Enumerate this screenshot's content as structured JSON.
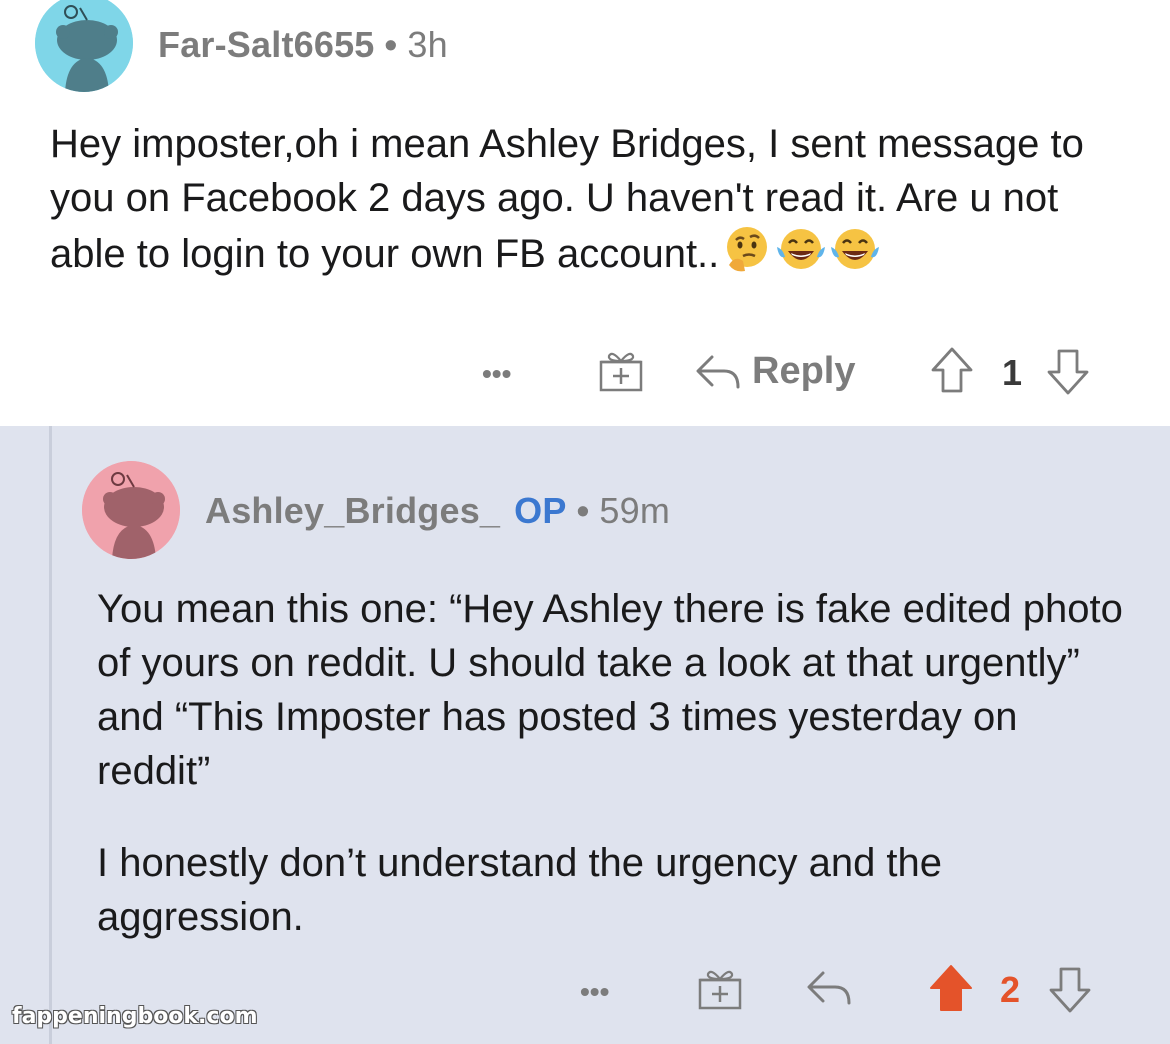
{
  "parent_comment": {
    "username": "Far-Salt6655",
    "separator": "•",
    "time": "3h",
    "avatar_color": "#7fd6e8",
    "body": "Hey imposter,oh i mean Ashley Bridges, I sent message to you on Facebook 2 days ago. U haven't read it. Are u not able to login to your own FB account..",
    "emojis": [
      "thinking-face-emoji",
      "tears-of-joy-emoji",
      "tears-of-joy-emoji"
    ],
    "actions": {
      "more": "•••",
      "reply_label": "Reply",
      "vote_count": "1"
    }
  },
  "reply_comment": {
    "username": "Ashley_Bridges_",
    "op_badge": "OP",
    "separator": "•",
    "time": "59m",
    "avatar_color": "#f0a2ac",
    "paragraph1": "You mean this one: “Hey Ashley there is fake edited photo of yours on reddit. U should take a look at that urgently” and “This Imposter has posted 3 times yesterday on reddit”",
    "paragraph2": "I honestly don’t understand the urgency and the aggression.",
    "actions": {
      "more": "•••",
      "vote_count": "2",
      "upvoted": true
    }
  },
  "colors": {
    "reply_background": "#dfe3ee",
    "op_blue": "#3b78d0",
    "upvote_orange": "#e4532a",
    "meta_gray": "#7c7c7c"
  },
  "watermark": "fappeningbook.com"
}
